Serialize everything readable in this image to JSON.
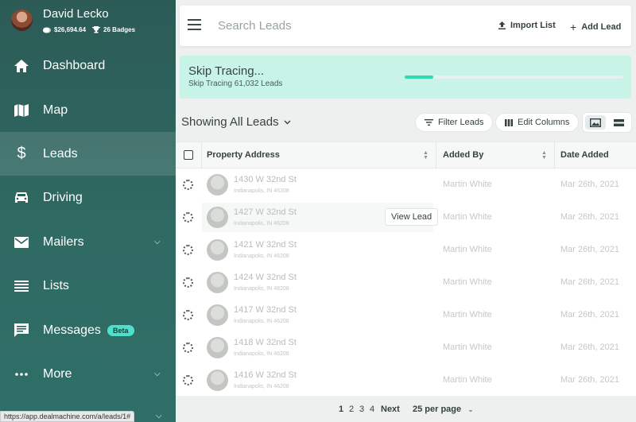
{
  "user": {
    "name": "David Lecko",
    "balance": "$26,694.64",
    "badges": "26 Badges"
  },
  "nav": [
    {
      "label": "Dashboard",
      "icon": "home-icon"
    },
    {
      "label": "Map",
      "icon": "map-icon"
    },
    {
      "label": "Leads",
      "icon": "dollar-icon",
      "active": true
    },
    {
      "label": "Driving",
      "icon": "car-icon"
    },
    {
      "label": "Mailers",
      "icon": "mail-icon",
      "expandable": true
    },
    {
      "label": "Lists",
      "icon": "list-icon"
    },
    {
      "label": "Messages",
      "icon": "chat-icon",
      "badge": "Beta"
    },
    {
      "label": "More",
      "icon": "more-icon",
      "expandable": true
    }
  ],
  "header": {
    "search_placeholder": "Search Leads",
    "import_label": "Import List",
    "add_label": "Add Lead"
  },
  "banner": {
    "title": "Skip Tracing...",
    "subtitle": "Skip Tracing 61,032 Leads",
    "progress": 0.13
  },
  "toolbar": {
    "showing_label": "Showing All Leads",
    "filter_label": "Filter Leads",
    "edit_columns_label": "Edit Columns"
  },
  "table": {
    "columns": [
      "Property Address",
      "Added By",
      "Date Added"
    ],
    "rows": [
      {
        "address": "1430 W 32nd St",
        "city": "Indianapolis, IN 46208",
        "added_by": "Martin White",
        "date": "Mar 26th, 2021"
      },
      {
        "address": "1427 W 32nd St",
        "city": "Indianapolis, IN 46208",
        "added_by": "Martin White",
        "date": "Mar 26th, 2021",
        "hover": true
      },
      {
        "address": "1421 W 32nd St",
        "city": "Indianapolis, IN 46208",
        "added_by": "Martin White",
        "date": "Mar 26th, 2021"
      },
      {
        "address": "1424 W 32nd St",
        "city": "Indianapolis, IN 46208",
        "added_by": "Martin White",
        "date": "Mar 26th, 2021"
      },
      {
        "address": "1417 W 32nd St",
        "city": "Indianapolis, IN 46208",
        "added_by": "Martin White",
        "date": "Mar 26th, 2021"
      },
      {
        "address": "1418 W 32nd St",
        "city": "Indianapolis, IN 46208",
        "added_by": "Martin White",
        "date": "Mar 26th, 2021"
      },
      {
        "address": "1416 W 32nd St",
        "city": "Indianapolis, IN 46208",
        "added_by": "Martin White",
        "date": "Mar 26th, 2021"
      }
    ],
    "view_lead_label": "View Lead"
  },
  "pagination": {
    "pages": [
      "1",
      "2",
      "3",
      "4"
    ],
    "current": "1",
    "next_label": "Next",
    "per_page_label": "25 per page"
  },
  "status_url": "https://app.dealmachine.com/a/leads/1#"
}
